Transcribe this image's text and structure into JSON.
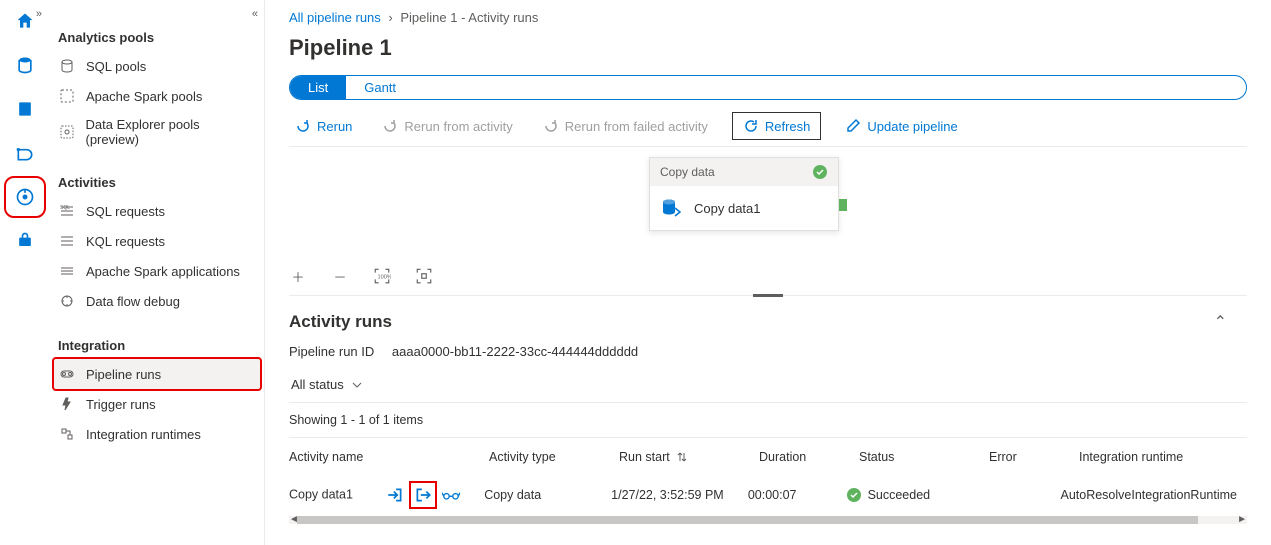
{
  "breadcrumb": {
    "root": "All pipeline runs",
    "current": "Pipeline 1 - Activity runs"
  },
  "page_title": "Pipeline 1",
  "view_toggle": {
    "list": "List",
    "gantt": "Gantt"
  },
  "toolbar": {
    "rerun": "Rerun",
    "rerun_activity": "Rerun from activity",
    "rerun_failed": "Rerun from failed activity",
    "refresh": "Refresh",
    "update": "Update pipeline"
  },
  "popup": {
    "title": "Copy data",
    "item": "Copy data1"
  },
  "section": {
    "title": "Activity runs",
    "runid_label": "Pipeline run ID",
    "runid_value": "aaaa0000-bb11-2222-33cc-444444dddddd",
    "status_filter": "All status",
    "showing": "Showing 1 - 1 of 1 items"
  },
  "columns": {
    "name": "Activity name",
    "type": "Activity type",
    "start": "Run start",
    "duration": "Duration",
    "status": "Status",
    "error": "Error",
    "ir": "Integration runtime"
  },
  "rows": [
    {
      "name": "Copy data1",
      "type": "Copy data",
      "start": "1/27/22, 3:52:59 PM",
      "duration": "00:00:07",
      "status": "Succeeded",
      "error": "",
      "ir": "AutoResolveIntegrationRuntime"
    }
  ],
  "sidebar": {
    "groups": [
      {
        "header": "Analytics pools",
        "items": [
          "SQL pools",
          "Apache Spark pools",
          "Data Explorer pools (preview)"
        ]
      },
      {
        "header": "Activities",
        "items": [
          "SQL requests",
          "KQL requests",
          "Apache Spark applications",
          "Data flow debug"
        ]
      },
      {
        "header": "Integration",
        "items": [
          "Pipeline runs",
          "Trigger runs",
          "Integration runtimes"
        ]
      }
    ]
  }
}
